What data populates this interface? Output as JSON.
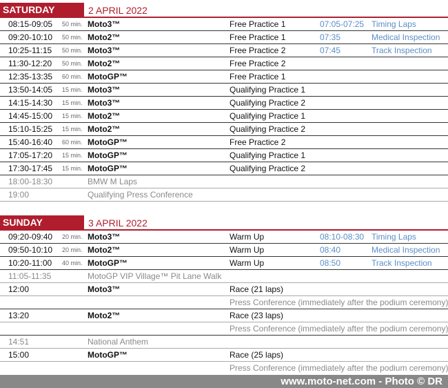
{
  "saturday": {
    "day": "SATURDAY",
    "date": "2 APRIL 2022",
    "rows": [
      {
        "time": "08:15-09:05",
        "dur": "50 min.",
        "class": "Moto3™",
        "session": "Free Practice 1",
        "extra_time": "07:05-07:25",
        "extra_label": "Timing Laps"
      },
      {
        "time": "09:20-10:10",
        "dur": "50 min.",
        "class": "Moto2™",
        "session": "Free Practice 1",
        "extra_time": "07:35",
        "extra_label": "Medical Inspection"
      },
      {
        "time": "10:25-11:15",
        "dur": "50 min.",
        "class": "Moto3™",
        "session": "Free Practice 2",
        "extra_time": "07:45",
        "extra_label": "Track Inspection"
      },
      {
        "time": "11:30-12:20",
        "dur": "50 min.",
        "class": "Moto2™",
        "session": "Free Practice 2",
        "extra_time": "",
        "extra_label": ""
      },
      {
        "time": "12:35-13:35",
        "dur": "60 min.",
        "class": "MotoGP™",
        "session": "Free Practice 1",
        "extra_time": "",
        "extra_label": ""
      },
      {
        "time": "13:50-14:05",
        "dur": "15 min.",
        "class": "Moto3™",
        "session": "Qualifying Practice 1",
        "extra_time": "",
        "extra_label": ""
      },
      {
        "time": "14:15-14:30",
        "dur": "15 min.",
        "class": "Moto3™",
        "session": "Qualifying Practice 2",
        "extra_time": "",
        "extra_label": ""
      },
      {
        "time": "14:45-15:00",
        "dur": "15 min.",
        "class": "Moto2™",
        "session": "Qualifying Practice 1",
        "extra_time": "",
        "extra_label": ""
      },
      {
        "time": "15:10-15:25",
        "dur": "15 min.",
        "class": "Moto2™",
        "session": "Qualifying Practice 2",
        "extra_time": "",
        "extra_label": ""
      },
      {
        "time": "15:40-16:40",
        "dur": "60 min.",
        "class": "MotoGP™",
        "session": "Free Practice 2",
        "extra_time": "",
        "extra_label": ""
      },
      {
        "time": "17:05-17:20",
        "dur": "15 min.",
        "class": "MotoGP™",
        "session": "Qualifying Practice 1",
        "extra_time": "",
        "extra_label": ""
      },
      {
        "time": "17:30-17:45",
        "dur": "15 min.",
        "class": "MotoGP™",
        "session": "Qualifying Practice 2",
        "extra_time": "",
        "extra_label": ""
      },
      {
        "time": "18:00-18:30",
        "dur": "",
        "class": "BMW M Laps",
        "session": "",
        "extra_time": "",
        "extra_label": "",
        "grey": true
      },
      {
        "time": "19:00",
        "dur": "",
        "class": "Qualifying Press Conference",
        "session": "",
        "extra_time": "",
        "extra_label": "",
        "grey": true
      }
    ]
  },
  "sunday": {
    "day": "SUNDAY",
    "date": "3 APRIL 2022",
    "rows": [
      {
        "time": "09:20-09:40",
        "dur": "20 min.",
        "class": "Moto3™",
        "session": "Warm Up",
        "extra_time": "08:10-08:30",
        "extra_label": "Timing Laps"
      },
      {
        "time": "09:50-10:10",
        "dur": "20 min.",
        "class": "Moto2™",
        "session": "Warm Up",
        "extra_time": "08:40",
        "extra_label": "Medical Inspection"
      },
      {
        "time": "10:20-11:00",
        "dur": "40 min.",
        "class": "MotoGP™",
        "session": "Warm Up",
        "extra_time": "08:50",
        "extra_label": "Track Inspection"
      },
      {
        "time": "11:05-11:35",
        "dur": "",
        "class": "MotoGP VIP Village™ Pit Lane Walk",
        "session": "",
        "extra_time": "",
        "extra_label": "",
        "grey": true
      }
    ],
    "races": [
      {
        "time": "12:00",
        "class": "Moto3™",
        "session": "Race (21 laps)",
        "note": "Press Conference (immediately after the podium ceremony)"
      },
      {
        "time": "13:20",
        "class": "Moto2™",
        "session": "Race (23 laps)",
        "note": "Press Conference (immediately after the podium ceremony)"
      }
    ],
    "anthem": {
      "time": "14:51",
      "label": "National Anthem"
    },
    "final_race": {
      "time": "15:00",
      "class": "MotoGP™",
      "session": "Race (25 laps)",
      "note": "Press Conference (immediately after the podium ceremony)"
    }
  },
  "footer": {
    "text": "www.moto-net.com - Photo © DR"
  }
}
